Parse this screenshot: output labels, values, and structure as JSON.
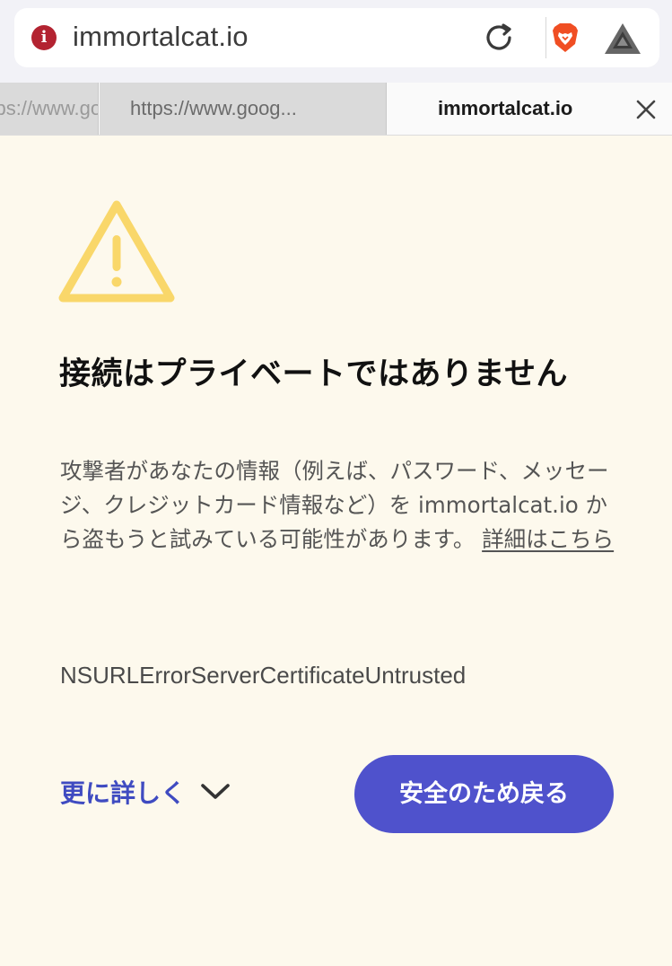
{
  "address_bar": {
    "url": "immortalcat.io",
    "icons": [
      "info-icon",
      "reload-icon",
      "brave-shields-icon",
      "bat-rewards-icon"
    ]
  },
  "tabs": [
    {
      "label": "https://www.goog..."
    },
    {
      "label": "https://www.goog..."
    },
    {
      "label": "immortalcat.io"
    }
  ],
  "content": {
    "title": "接続はプライベートではありません",
    "description": "攻撃者があなたの情報（例えば、パスワード、メッセージ、クレジットカード情報など）を immortalcat.io から盗もうと試みている可能性があります。",
    "details_link": "詳細はこちら",
    "error_code": "NSURLErrorServerCertificateUntrusted",
    "more_label": "更に詳しく",
    "back_button": "安全のため戻る"
  },
  "colors": {
    "page_bg": "#fdf9ed",
    "warning": "#f9d76a",
    "accent": "#4f52cc",
    "link": "#3f4bc1",
    "info_icon": "#b32331"
  }
}
